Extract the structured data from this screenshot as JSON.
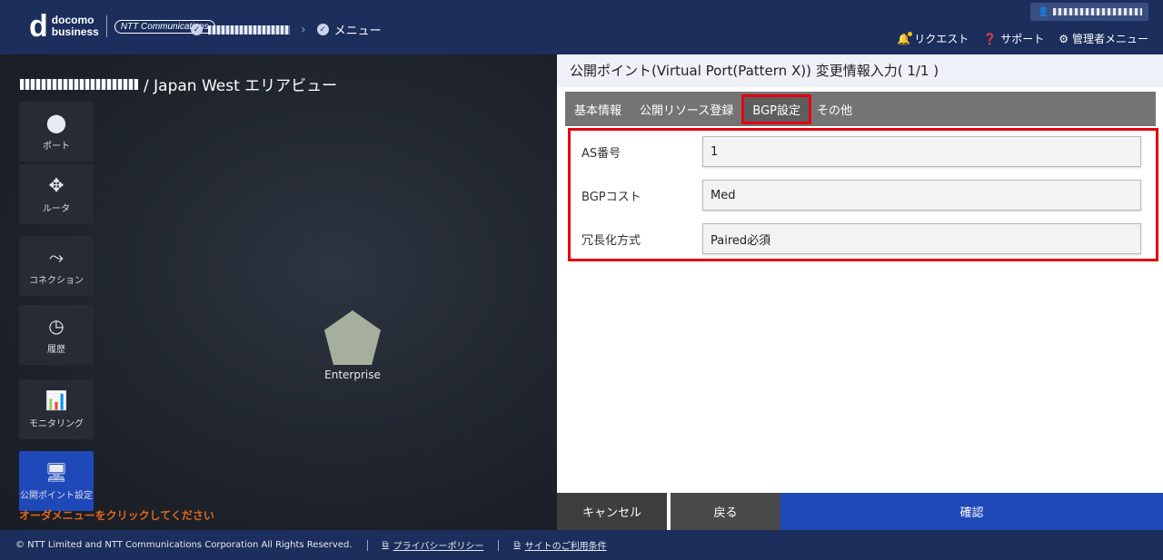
{
  "header": {
    "logo_line1": "docomo",
    "logo_line2": "business",
    "ntt_logo": "NTT Communications",
    "breadcrumb_menu": "メニュー",
    "nav": {
      "request": "リクエスト",
      "support": "サポート",
      "admin_menu": "管理者メニュー"
    },
    "icons": {
      "user": "user-icon",
      "bell": "bell-icon",
      "help": "help-icon",
      "gear": "gear-icon"
    }
  },
  "left": {
    "area_suffix": "/ Japan West エリアビュー",
    "menu": [
      {
        "label": "ポート",
        "icon": "port-icon"
      },
      {
        "label": "ルータ",
        "icon": "router-icon"
      },
      {
        "label": "コネクション",
        "icon": "connection-icon"
      },
      {
        "label": "履歴",
        "icon": "history-icon"
      },
      {
        "label": "モニタリング",
        "icon": "monitoring-icon"
      },
      {
        "label": "公開ポイント設定",
        "icon": "public-point-icon"
      }
    ],
    "enterprise_label": "Enterprise",
    "hint": "オーダメニューをクリックしてください"
  },
  "panel": {
    "title": "公開ポイント(Virtual Port(Pattern X)) 変更情報入力( 1/1 )",
    "tabs": [
      "基本情報",
      "公開リソース登録",
      "BGP設定",
      "その他"
    ],
    "active_tab": "BGP設定",
    "fields": [
      {
        "label": "AS番号",
        "value": "1"
      },
      {
        "label": "BGPコスト",
        "value": "Med"
      },
      {
        "label": "冗長化方式",
        "value": "Paired必須"
      }
    ]
  },
  "actions": {
    "cancel": "キャンセル",
    "back": "戻る",
    "confirm": "確認"
  },
  "footer": {
    "copyright": "© NTT Limited and NTT Communications Corporation All Rights Reserved.",
    "privacy": "プライバシーポリシー",
    "terms": "サイトのご利用条件"
  },
  "colors": {
    "header_bg": "#1b2e5c",
    "accent_blue": "#1f49b8",
    "highlight_red": "#e3000f",
    "hint_orange": "#e2661c",
    "tab_bar": "#747474"
  }
}
